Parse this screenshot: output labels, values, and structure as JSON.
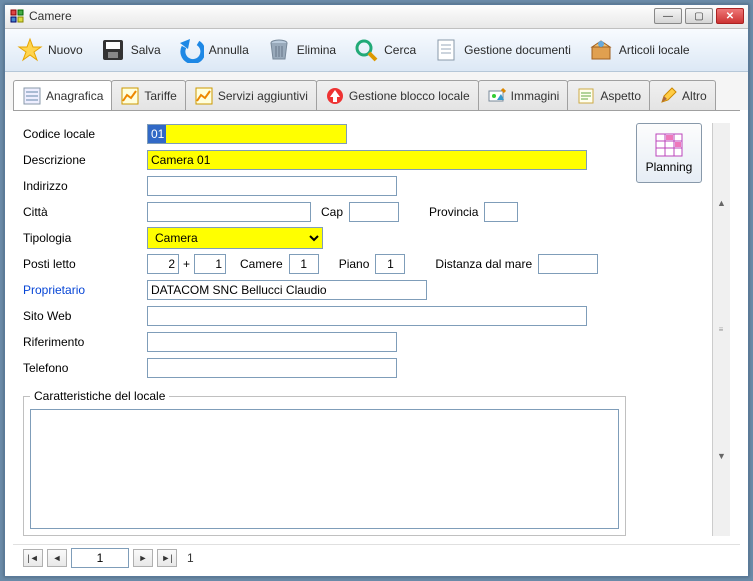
{
  "window": {
    "title": "Camere"
  },
  "toolbar": {
    "nuovo": "Nuovo",
    "salva": "Salva",
    "annulla": "Annulla",
    "elimina": "Elimina",
    "cerca": "Cerca",
    "gestione_documenti": "Gestione documenti",
    "articoli_locale": "Articoli locale"
  },
  "tabs": {
    "anagrafica": "Anagrafica",
    "tariffe": "Tariffe",
    "servizi": "Servizi aggiuntivi",
    "blocco": "Gestione blocco locale",
    "immagini": "Immagini",
    "aspetto": "Aspetto",
    "altro": "Altro"
  },
  "labels": {
    "codice_locale": "Codice locale",
    "descrizione": "Descrizione",
    "indirizzo": "Indirizzo",
    "citta": "Città",
    "cap": "Cap",
    "provincia": "Provincia",
    "tipologia": "Tipologia",
    "posti_letto": "Posti letto",
    "plus": "+",
    "camere": "Camere",
    "piano": "Piano",
    "distanza_mare": "Distanza dal  mare",
    "proprietario": "Proprietario",
    "sito_web": "Sito Web",
    "riferimento": "Riferimento",
    "telefono": "Telefono",
    "caratteristiche": "Caratteristiche del locale"
  },
  "values": {
    "codice_locale": "01",
    "descrizione": "Camera 01",
    "indirizzo": "",
    "citta": "",
    "cap": "",
    "provincia": "",
    "tipologia": "Camera",
    "posti1": "2",
    "posti2": "1",
    "camere": "1",
    "piano": "1",
    "distanza": "",
    "proprietario": "DATACOM SNC Bellucci Claudio",
    "sito_web": "",
    "riferimento": "",
    "telefono": ""
  },
  "side": {
    "planning": "Planning"
  },
  "nav": {
    "page": "1",
    "total": "1"
  }
}
